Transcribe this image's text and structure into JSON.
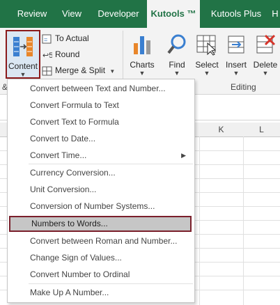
{
  "tabs": [
    "Review",
    "View",
    "Developer",
    "Kutools ™",
    "Kutools Plus",
    "H"
  ],
  "active_tab": "Kutools ™",
  "ribbon": {
    "content_label": "Content",
    "to_actual": "To Actual",
    "round": "Round",
    "merge_split": "Merge & Split",
    "charts": "Charts",
    "find": "Find",
    "select": "Select",
    "insert": "Insert",
    "delete": "Delete",
    "editing_group": "Editing",
    "clipped_label": "&"
  },
  "columns": [
    "K",
    "L"
  ],
  "menu": {
    "items": [
      "Convert between Text and Number...",
      "Convert Formula to Text",
      "Convert Text to Formula",
      "Convert to Date...",
      "Convert Time...",
      "Currency Conversion...",
      "Unit Conversion...",
      "Conversion of Number Systems...",
      "Numbers to Words...",
      "Convert between Roman and Number...",
      "Change Sign of Values...",
      "Convert Number to Ordinal",
      "Make Up A Number..."
    ],
    "highlighted": "Numbers to Words..."
  },
  "colors": {
    "tab_bar": "#217346",
    "highlight_border": "#7a1f2b",
    "highlight_fill": "#c6c6c6"
  }
}
